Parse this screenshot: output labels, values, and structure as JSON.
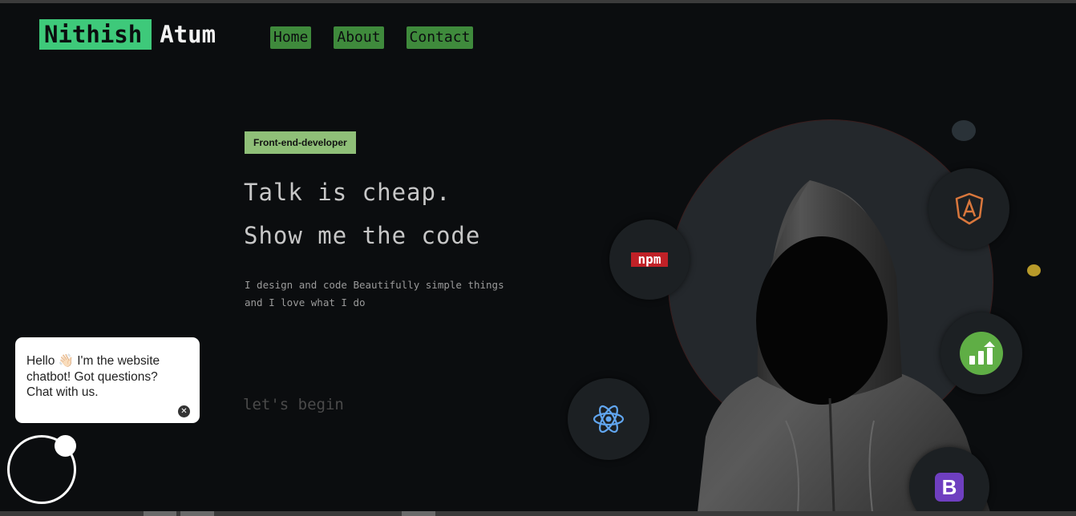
{
  "brand": {
    "first": "Nithish",
    "last": "Atum"
  },
  "nav": [
    {
      "label": "Home"
    },
    {
      "label": "About"
    },
    {
      "label": "Contact"
    }
  ],
  "hero": {
    "badge": "Front-end-developer",
    "headline_1": "Talk is cheap.",
    "headline_2": "Show me the code",
    "desc_1": "I design and code Beautifully simple things",
    "desc_2": "and I love what I do",
    "cta": "let's begin"
  },
  "tech_icons": {
    "npm": "npm",
    "bootstrap": "B",
    "react": "react-icon",
    "angular": "angular-icon",
    "stats": "stats-icon"
  },
  "chatbot": {
    "line_1": "Hello 👋🏻 I'm the website",
    "line_2": "chatbot! Got questions?",
    "line_3": "Chat with us.",
    "close_glyph": "✕"
  },
  "colors": {
    "accent_green": "#3ec97a",
    "nav_green": "#3f8a3c",
    "badge_green": "#8fbf78",
    "background": "#0b0d0f"
  }
}
